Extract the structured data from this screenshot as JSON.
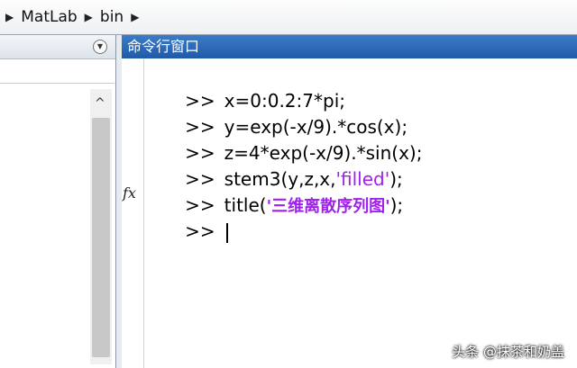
{
  "breadcrumb": {
    "segments": [
      "MatLab",
      "bin"
    ]
  },
  "command_window": {
    "title": "命令行窗口",
    "prompt": ">>",
    "fx_label": "fx",
    "lines": [
      {
        "code": "x=0:0.2:7*pi;"
      },
      {
        "code": "y=exp(-x/9).*cos(x);"
      },
      {
        "code": "z=4*exp(-x/9).*sin(x);"
      },
      {
        "code_before": "stem3(y,z,x,",
        "string": "'filled'",
        "code_after": ");"
      },
      {
        "code_before": "title(",
        "string": "'三维离散序列图'",
        "code_after": ");"
      }
    ]
  },
  "watermark": "头条 @抹茶和奶盖",
  "colors": {
    "titlebar": "#2a66b5",
    "string": "#a020f0"
  }
}
